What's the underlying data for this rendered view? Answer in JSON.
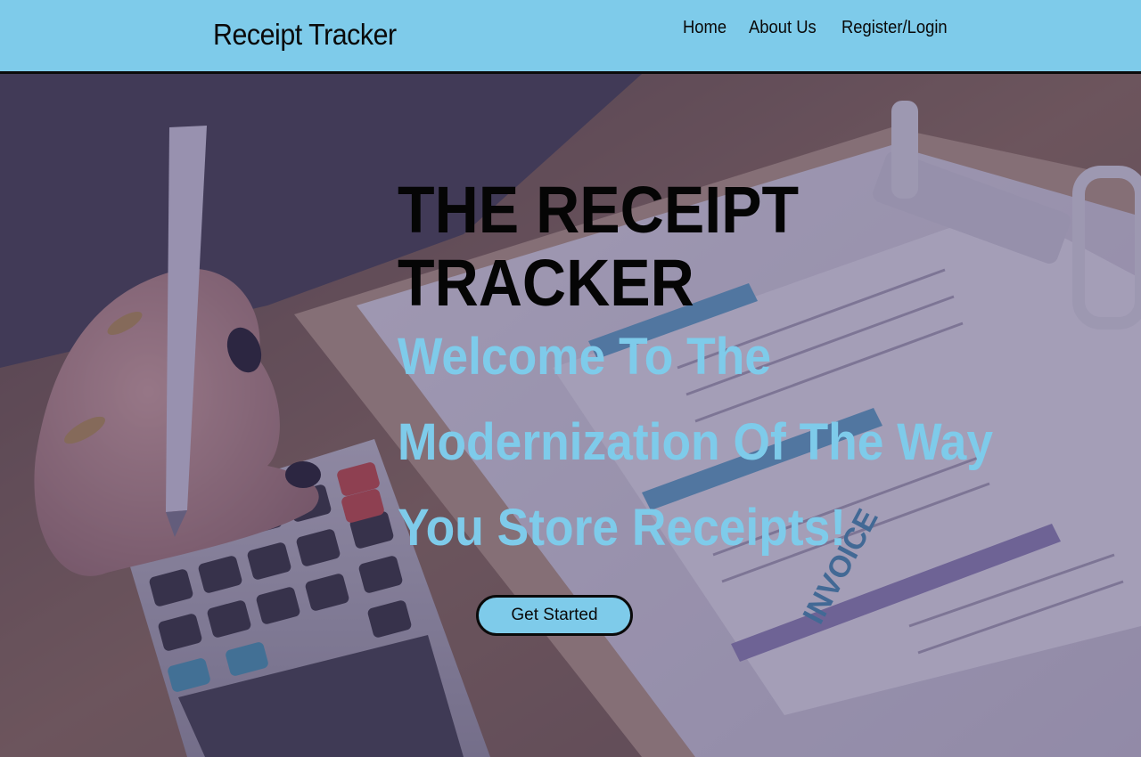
{
  "navbar": {
    "brand": "Receipt Tracker",
    "links": [
      "Home",
      "About Us",
      "Register/Login"
    ]
  },
  "hero": {
    "title": "THE RECEIPT TRACKER",
    "subtitle": "Welcome To The Modernization Of The Way You Store Receipts!",
    "cta_label": "Get Started"
  },
  "colors": {
    "accent": "#7ecbea",
    "text_dark": "#0a0a0a"
  }
}
